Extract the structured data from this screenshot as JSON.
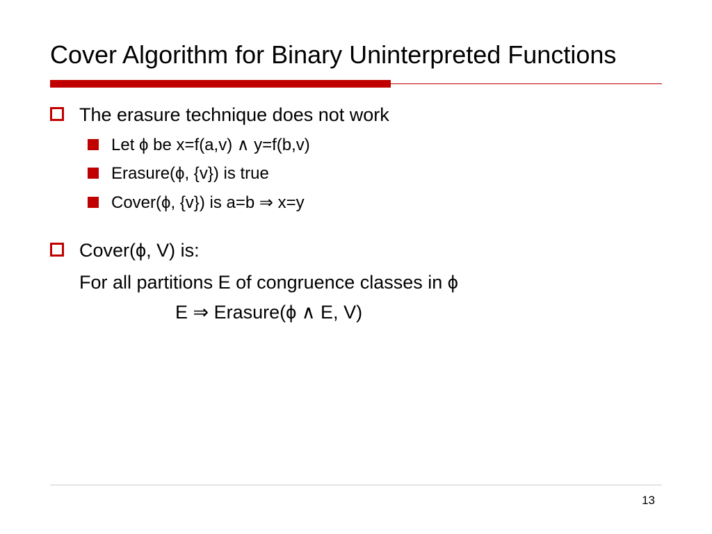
{
  "title": "Cover Algorithm for Binary Uninterpreted Functions",
  "bullets": {
    "b1": "The erasure technique does not work",
    "b1a": "Let ϕ be x=f(a,v) ∧ y=f(b,v)",
    "b1b": "Erasure(ϕ, {v}) is true",
    "b1c": "Cover(ϕ, {v}) is a=b ⇒ x=y",
    "b2": "Cover(ϕ, V) is:",
    "b2a": "For all partitions E of congruence classes in ϕ",
    "b2b": "E ⇒ Erasure(ϕ ∧ E, V)"
  },
  "page": "13"
}
